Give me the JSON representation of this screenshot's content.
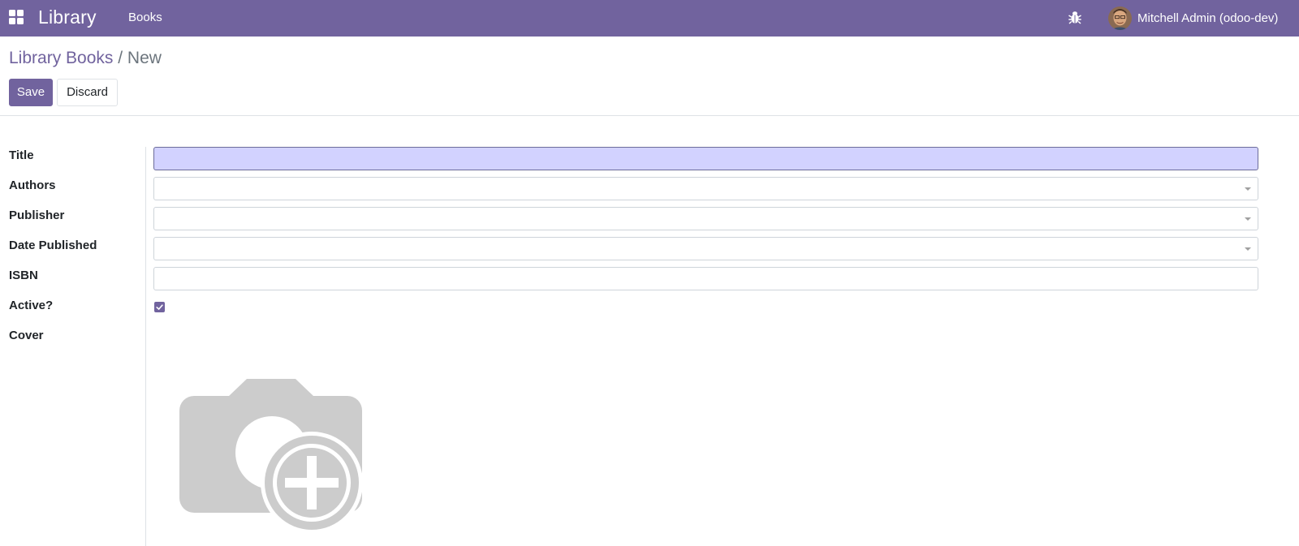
{
  "navbar": {
    "app_name": "Library",
    "menu_books": "Books",
    "user_name": "Mitchell Admin (odoo-dev)",
    "accent_color": "#71639e"
  },
  "breadcrumb": {
    "parent": "Library Books",
    "separator": "/",
    "current": "New"
  },
  "buttons": {
    "save": "Save",
    "discard": "Discard"
  },
  "form": {
    "title_label": "Title",
    "title_value": "",
    "authors_label": "Authors",
    "authors_value": "",
    "publisher_label": "Publisher",
    "publisher_value": "",
    "date_label": "Date Published",
    "date_value": "",
    "isbn_label": "ISBN",
    "isbn_value": "",
    "active_label": "Active?",
    "active_checked": true,
    "cover_label": "Cover"
  },
  "icons": {
    "apps": "apps-grid-icon",
    "debug": "bug-icon",
    "cover_placeholder": "camera-plus-icon"
  }
}
